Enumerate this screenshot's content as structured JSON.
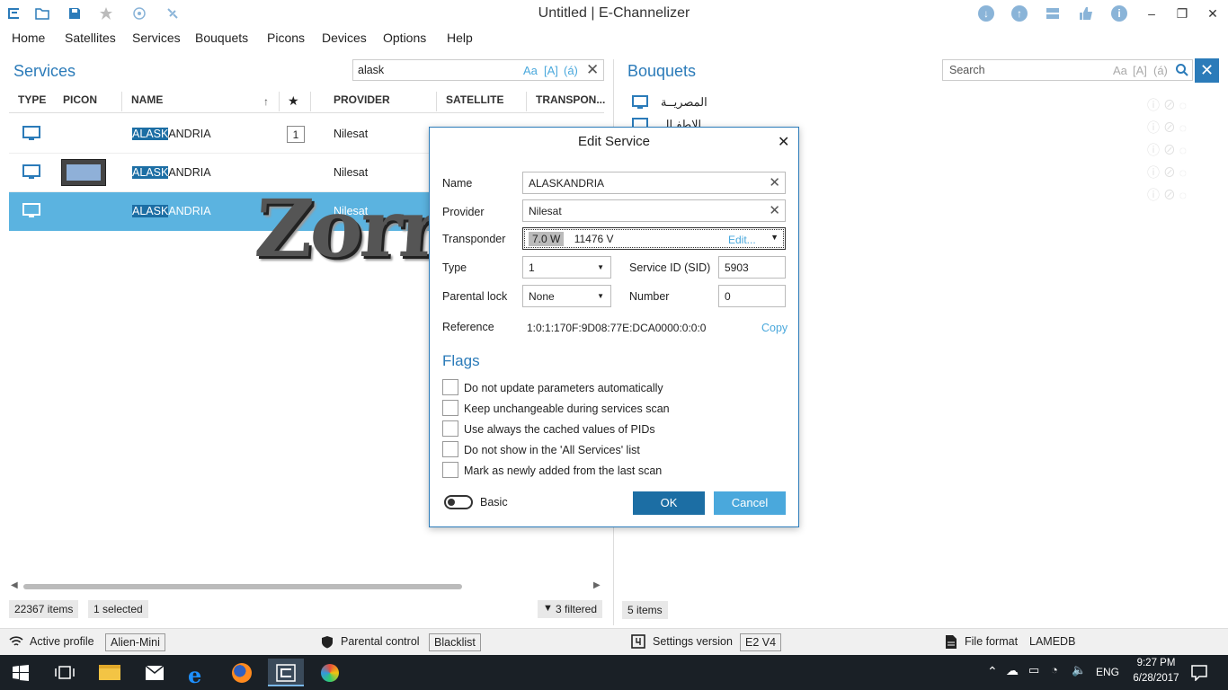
{
  "window": {
    "title": "Untitled | E-Channelizer"
  },
  "menu": [
    "Home",
    "Satellites",
    "Services",
    "Bouquets",
    "Picons",
    "Devices",
    "Options",
    "Help"
  ],
  "services": {
    "title": "Services",
    "search_value": "alask",
    "search_opts": {
      "case": "Aa",
      "word": "[A]",
      "accent": "(á)"
    },
    "columns": [
      "TYPE",
      "PICON",
      "NAME",
      "PROVIDER",
      "SATELLITE",
      "TRANSPON..."
    ],
    "rows": [
      {
        "name_hl": "ALASK",
        "name_rest": "ANDRIA",
        "number": "1",
        "provider": "Nilesat"
      },
      {
        "name_hl": "ALASK",
        "name_rest": "ANDRIA",
        "number": "",
        "provider": "Nilesat"
      },
      {
        "name_hl": "ALASK",
        "name_rest": "ANDRIA",
        "number": "",
        "provider": "Nilesat"
      }
    ],
    "items_count": "22367 items",
    "selected": "1 selected",
    "filtered": "3 filtered"
  },
  "bouquets": {
    "title": "Bouquets",
    "search_placeholder": "Search",
    "search_opts": {
      "case": "Aa",
      "word": "[A]",
      "accent": "(á)"
    },
    "items": [
      "المصريــة",
      "الاطفـال"
    ],
    "items_count": "5 items"
  },
  "overlay_text": "Zorro",
  "dialog": {
    "title": "Edit Service",
    "name_label": "Name",
    "name_value": "ALASKANDRIA",
    "provider_label": "Provider",
    "provider_value": "Nilesat",
    "transponder_label": "Transponder",
    "transponder_sat": "7.0 W",
    "transponder_value": "11476 V",
    "transponder_edit": "Edit...",
    "type_label": "Type",
    "type_value": "1",
    "sid_label": "Service ID (SID)",
    "sid_value": "5903",
    "parental_label": "Parental lock",
    "parental_value": "None",
    "number_label": "Number",
    "number_value": "0",
    "reference_label": "Reference",
    "reference_value": "1:0:1:170F:9D08:77E:DCA0000:0:0:0",
    "copy_label": "Copy",
    "flags_title": "Flags",
    "flags": [
      "Do not update parameters automatically",
      "Keep unchangeable during services scan",
      "Use always the cached values of PIDs",
      "Do not show in the 'All Services' list",
      "Mark as newly added from the last scan"
    ],
    "basic_label": "Basic",
    "ok_label": "OK",
    "cancel_label": "Cancel"
  },
  "statusbar": {
    "active_profile_label": "Active profile",
    "active_profile_value": "Alien-Mini",
    "parental_label": "Parental control",
    "parental_value": "Blacklist",
    "settings_label": "Settings version",
    "settings_value": "E2 V4",
    "file_format_label": "File format",
    "file_format_value": "LAMEDB"
  },
  "taskbar": {
    "lang": "ENG",
    "time": "9:27 PM",
    "date": "6/28/2017"
  },
  "colors": {
    "accent": "#2b7bb9",
    "selection": "#5bb3e0",
    "ok": "#1c6ea4",
    "cancel": "#4aa8dc"
  }
}
